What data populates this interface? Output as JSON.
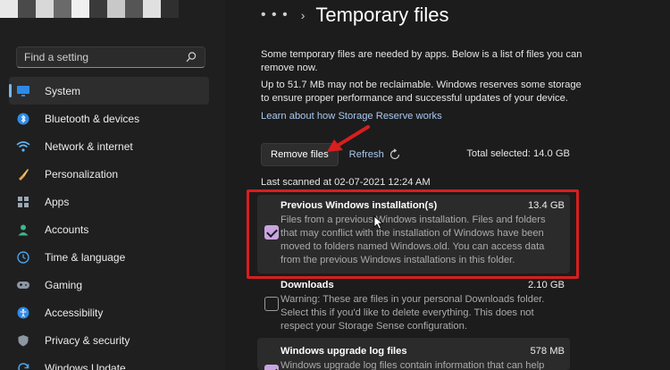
{
  "window": {
    "title": "Temporary files"
  },
  "sidebar": {
    "search_placeholder": "Find a setting",
    "items": [
      {
        "label": "System",
        "icon": "monitor-icon",
        "active": true
      },
      {
        "label": "Bluetooth & devices",
        "icon": "bluetooth-icon"
      },
      {
        "label": "Network & internet",
        "icon": "wifi-icon"
      },
      {
        "label": "Personalization",
        "icon": "brush-icon"
      },
      {
        "label": "Apps",
        "icon": "apps-icon"
      },
      {
        "label": "Accounts",
        "icon": "person-icon"
      },
      {
        "label": "Time & language",
        "icon": "globe-clock-icon"
      },
      {
        "label": "Gaming",
        "icon": "gamepad-icon"
      },
      {
        "label": "Accessibility",
        "icon": "accessibility-icon"
      },
      {
        "label": "Privacy & security",
        "icon": "shield-icon"
      },
      {
        "label": "Windows Update",
        "icon": "update-icon"
      }
    ]
  },
  "header": {
    "breadcrumb_more": "• • •",
    "chevron": "›",
    "title": "Temporary files"
  },
  "main": {
    "intro": "Some temporary files are needed by apps. Below is a list of files you can remove now.",
    "reserve_note": "Up to 51.7 MB may not be reclaimable. Windows reserves some storage to ensure proper performance and successful updates of your device.",
    "reserve_link": "Learn about how Storage Reserve works",
    "remove_button": "Remove files",
    "refresh_link": "Refresh",
    "total_selected": "Total selected: 14.0 GB",
    "last_scanned": "Last scanned at 02-07-2021 12:24 AM",
    "files": [
      {
        "name": "Previous Windows installation(s)",
        "size": "13.4 GB",
        "description": "Files from a previous Windows installation.  Files and folders that may conflict with the installation of Windows have been moved to folders named Windows.old.  You can access data from the previous Windows installations in this folder.",
        "checked": true
      },
      {
        "name": "Downloads",
        "size": "2.10 GB",
        "description": "Warning: These are files in your personal Downloads folder. Select this if you'd like to delete everything. This does not respect your Storage Sense configuration.",
        "checked": false
      },
      {
        "name": "Windows upgrade log files",
        "size": "578 MB",
        "description": "Windows upgrade log files contain information that can help",
        "checked": true
      }
    ]
  },
  "colors": {
    "accent": "#76b9ed",
    "checkbox": "#c9a4e1",
    "highlight": "#d81e1e",
    "link": "#a8c8f0"
  }
}
